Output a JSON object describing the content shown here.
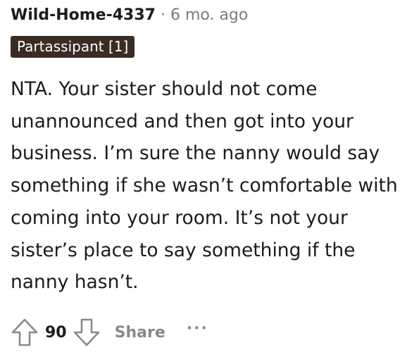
{
  "comment": {
    "author": "Wild-Home-4337",
    "separator": "·",
    "timestamp": "6 mo. ago",
    "flair": "Partassipant [1]",
    "body": "NTA. Your sister should not come unannounced and then got into your business. I’m sure the nanny would say something if she wasn’t comfortable with coming into your room. It’s not your sister’s place to say something if the nanny hasn’t.",
    "score": "90",
    "share_label": "Share",
    "more_label": "···"
  },
  "icons": {
    "upvote": "upvote-arrow-icon",
    "downvote": "downvote-arrow-icon"
  },
  "colors": {
    "flair_background": "#3a2c25",
    "muted_text": "#878a8c",
    "primary_text": "#1c1c1c"
  }
}
